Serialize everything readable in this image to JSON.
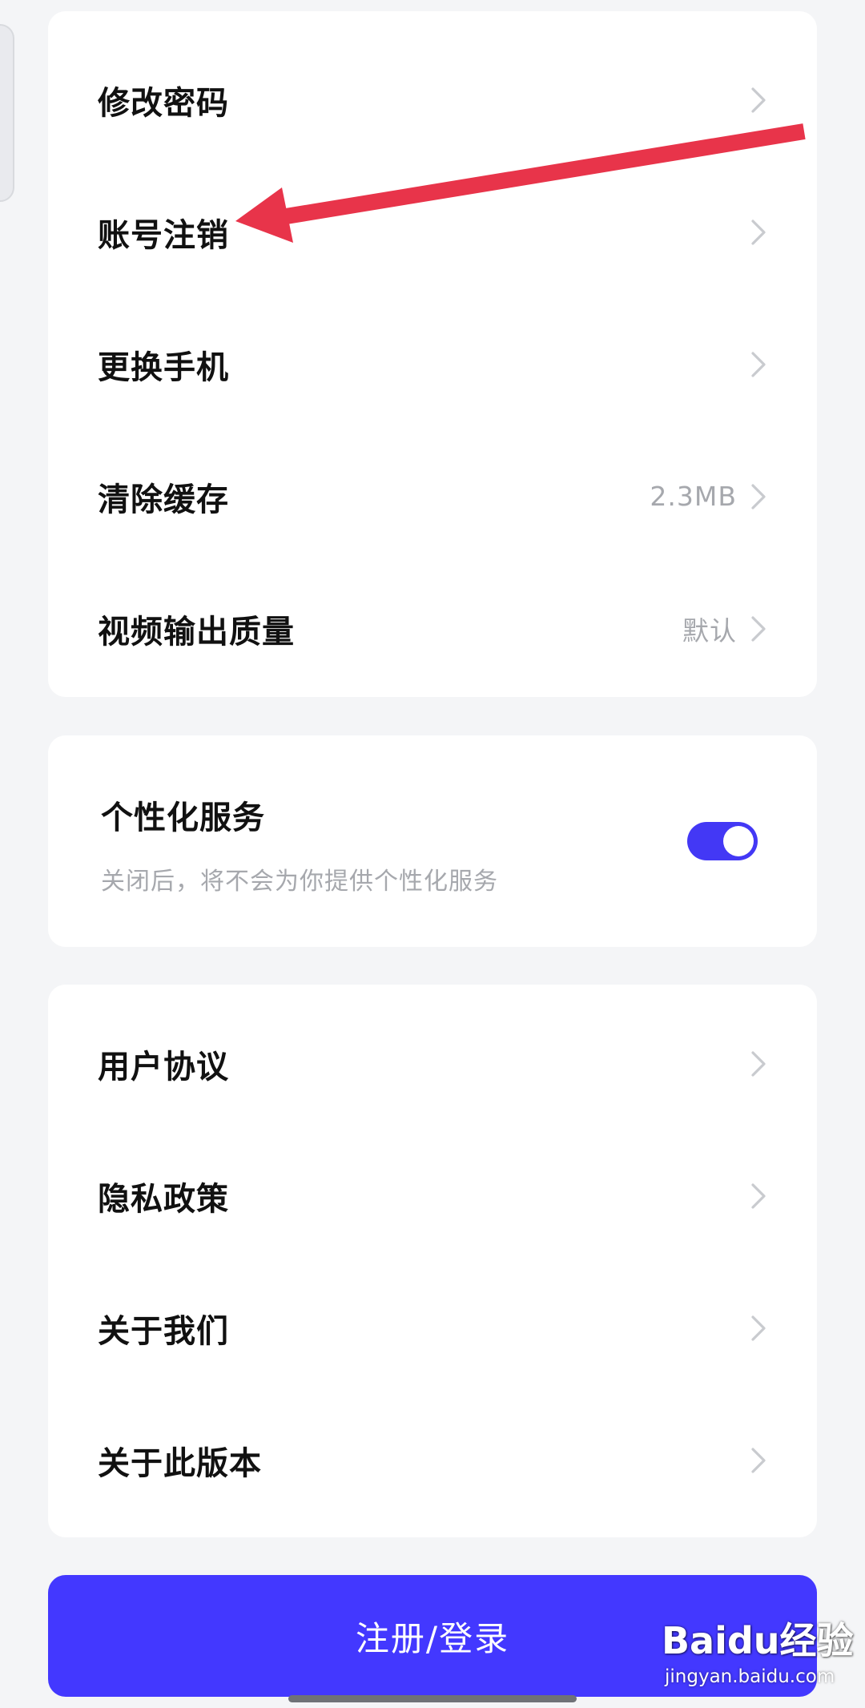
{
  "account_section": {
    "items": [
      {
        "label": "修改密码",
        "value": ""
      },
      {
        "label": "账号注销",
        "value": ""
      },
      {
        "label": "更换手机",
        "value": ""
      },
      {
        "label": "清除缓存",
        "value": "2.3MB"
      },
      {
        "label": "视频输出质量",
        "value": "默认"
      }
    ]
  },
  "personalization": {
    "title": "个性化服务",
    "description": "关闭后，将不会为你提供个性化服务",
    "toggle_on": true
  },
  "about_section": {
    "items": [
      {
        "label": "用户协议"
      },
      {
        "label": "隐私政策"
      },
      {
        "label": "关于我们"
      },
      {
        "label": "关于此版本"
      }
    ]
  },
  "login_button": {
    "label": "注册/登录"
  },
  "watermark": {
    "logo": "Baidu经验",
    "url": "jingyan.baidu.com"
  },
  "colors": {
    "accent": "#4338ff",
    "annotation_arrow": "#e8344a",
    "background": "#f4f5f7"
  },
  "icons": {
    "chevron": "chevron-right-icon",
    "annotation": "red-arrow-annotation"
  }
}
